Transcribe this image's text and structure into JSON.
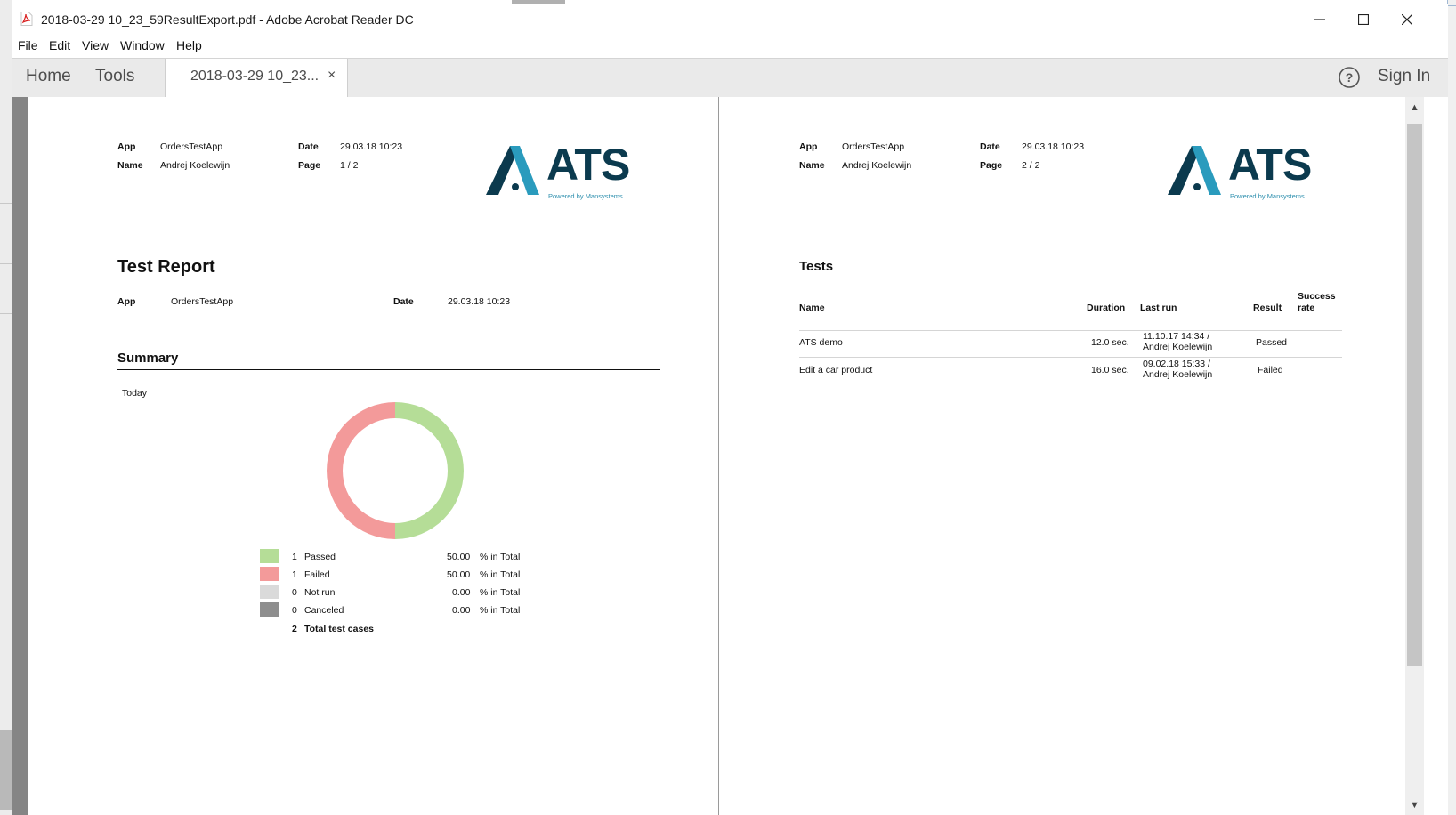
{
  "window": {
    "title": "2018-03-29 10_23_59ResultExport.pdf - Adobe Acrobat Reader DC",
    "controls": {
      "minimize": "─",
      "maximize": "☐",
      "close": "✕"
    }
  },
  "menu": {
    "items": [
      "File",
      "Edit",
      "View",
      "Window",
      "Help"
    ]
  },
  "tabs": {
    "home": "Home",
    "tools": "Tools",
    "document": "2018-03-29 10_23...",
    "close": "×",
    "sign_in": "Sign In",
    "help": "?"
  },
  "page1": {
    "header": {
      "app_label": "App",
      "app_value": "OrdersTestApp",
      "name_label": "Name",
      "name_value": "Andrej Koelewijn",
      "date_label": "Date",
      "date_value": "29.03.18 10:23",
      "page_label": "Page",
      "page_value": "1 / 2"
    },
    "logo": {
      "text": "ATS",
      "tagline": "Powered by Mansystems"
    },
    "report_title": "Test Report",
    "info": {
      "app_label": "App",
      "app_value": "OrdersTestApp",
      "date_label": "Date",
      "date_value": "29.03.18 10:23"
    },
    "summary_title": "Summary",
    "today": "Today",
    "legend": [
      {
        "count": "1",
        "label": "Passed",
        "percent": "50.00",
        "suffix": "% in Total",
        "color": "#b5dd97"
      },
      {
        "count": "1",
        "label": "Failed",
        "percent": "50.00",
        "suffix": "% in Total",
        "color": "#f39a9a"
      },
      {
        "count": "0",
        "label": "Not run",
        "percent": "0.00",
        "suffix": "% in Total",
        "color": "#dadada"
      },
      {
        "count": "0",
        "label": "Canceled",
        "percent": "0.00",
        "suffix": "% in Total",
        "color": "#8e8e8e"
      }
    ],
    "total": {
      "count": "2",
      "label": "Total test cases"
    }
  },
  "page2": {
    "header": {
      "app_label": "App",
      "app_value": "OrdersTestApp",
      "name_label": "Name",
      "name_value": "Andrej Koelewijn",
      "date_label": "Date",
      "date_value": "29.03.18 10:23",
      "page_label": "Page",
      "page_value": "2 / 2"
    },
    "logo": {
      "text": "ATS",
      "tagline": "Powered by Mansystems"
    },
    "tests_title": "Tests",
    "columns": {
      "name": "Name",
      "duration": "Duration",
      "last_run": "Last run",
      "result": "Result",
      "success_1": "Success",
      "success_2": "rate"
    },
    "rows": [
      {
        "name": "ATS demo",
        "duration": "12.0 sec.",
        "last_run_1": "11.10.17 14:34 /",
        "last_run_2": "Andrej Koelewijn",
        "result": "Passed"
      },
      {
        "name": "Edit a car product",
        "duration": "16.0 sec.",
        "last_run_1": "09.02.18 15:33 /",
        "last_run_2": "Andrej Koelewijn",
        "result": "Failed"
      }
    ]
  },
  "colors": {
    "passed": "#b5dd97",
    "failed": "#f39a9a",
    "logo": "#0b3a4e"
  }
}
